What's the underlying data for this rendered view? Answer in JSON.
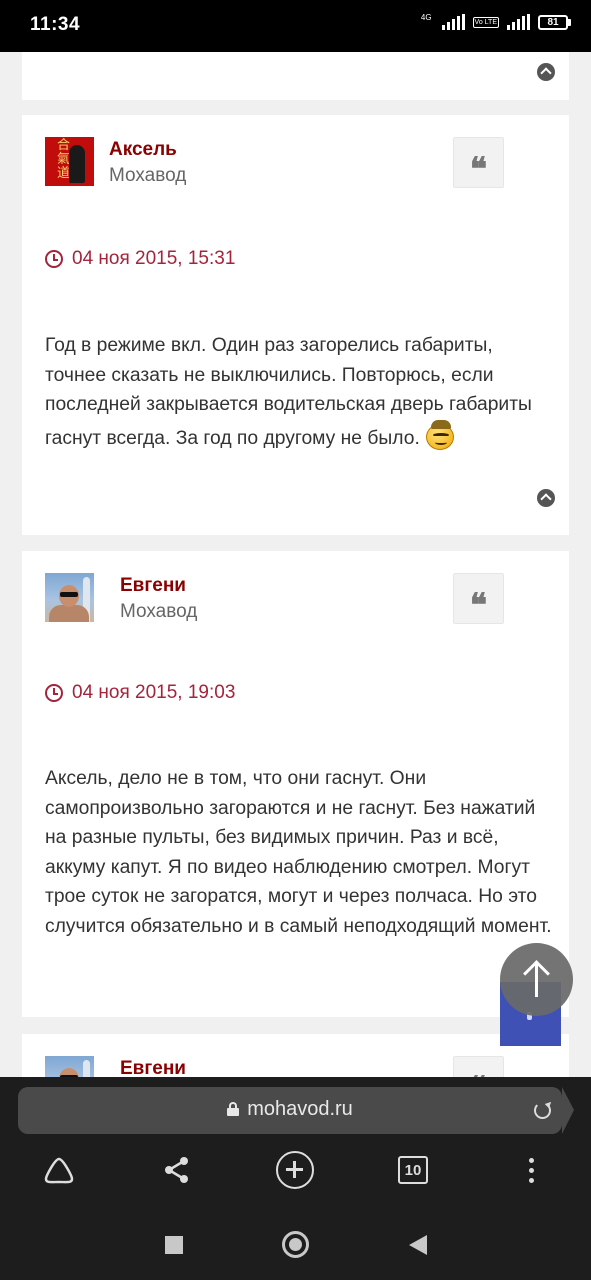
{
  "status_bar": {
    "time": "11:34",
    "network_label": "4G",
    "volte_label": "Vo LTE",
    "battery": "81"
  },
  "posts": [
    {
      "author": "Аксель",
      "rank": "Мохавод",
      "date": "04 ноя 2015, 15:31",
      "text": "Год в режиме вкл. Один раз загорелись габариты, точнее сказать не выключились. Повторюсь, если последней закрывается водительская дверь габариты гаснут всегда. За год по другому не было.",
      "avatar": "red-emblem-avatar",
      "emoji": "smiley-emoji"
    },
    {
      "author": "Евгени",
      "rank": "Мохавод",
      "date": "04 ноя 2015, 19:03",
      "text": "Аксель, дело не в том, что они гаснут. Они самопроизвольно загораются и не гаснут. Без нажатий на разные пульты, без видимых причин. Раз и всё, аккуму капут. Я по видео наблюдению смотрел. Могут трое суток не загоратся, могут и через полчаса. Но это случится обязательно и в самый неподходящий момент.",
      "avatar": "photo-avatar"
    },
    {
      "author": "Евгени",
      "avatar": "photo-avatar"
    }
  ],
  "quote_icon_glyph": "❝",
  "browser": {
    "url": "mohavod.ru",
    "tab_count": "10"
  },
  "colors": {
    "author": "#8b0000",
    "date": "#a4243b",
    "fab_back": "#3f51b5"
  }
}
